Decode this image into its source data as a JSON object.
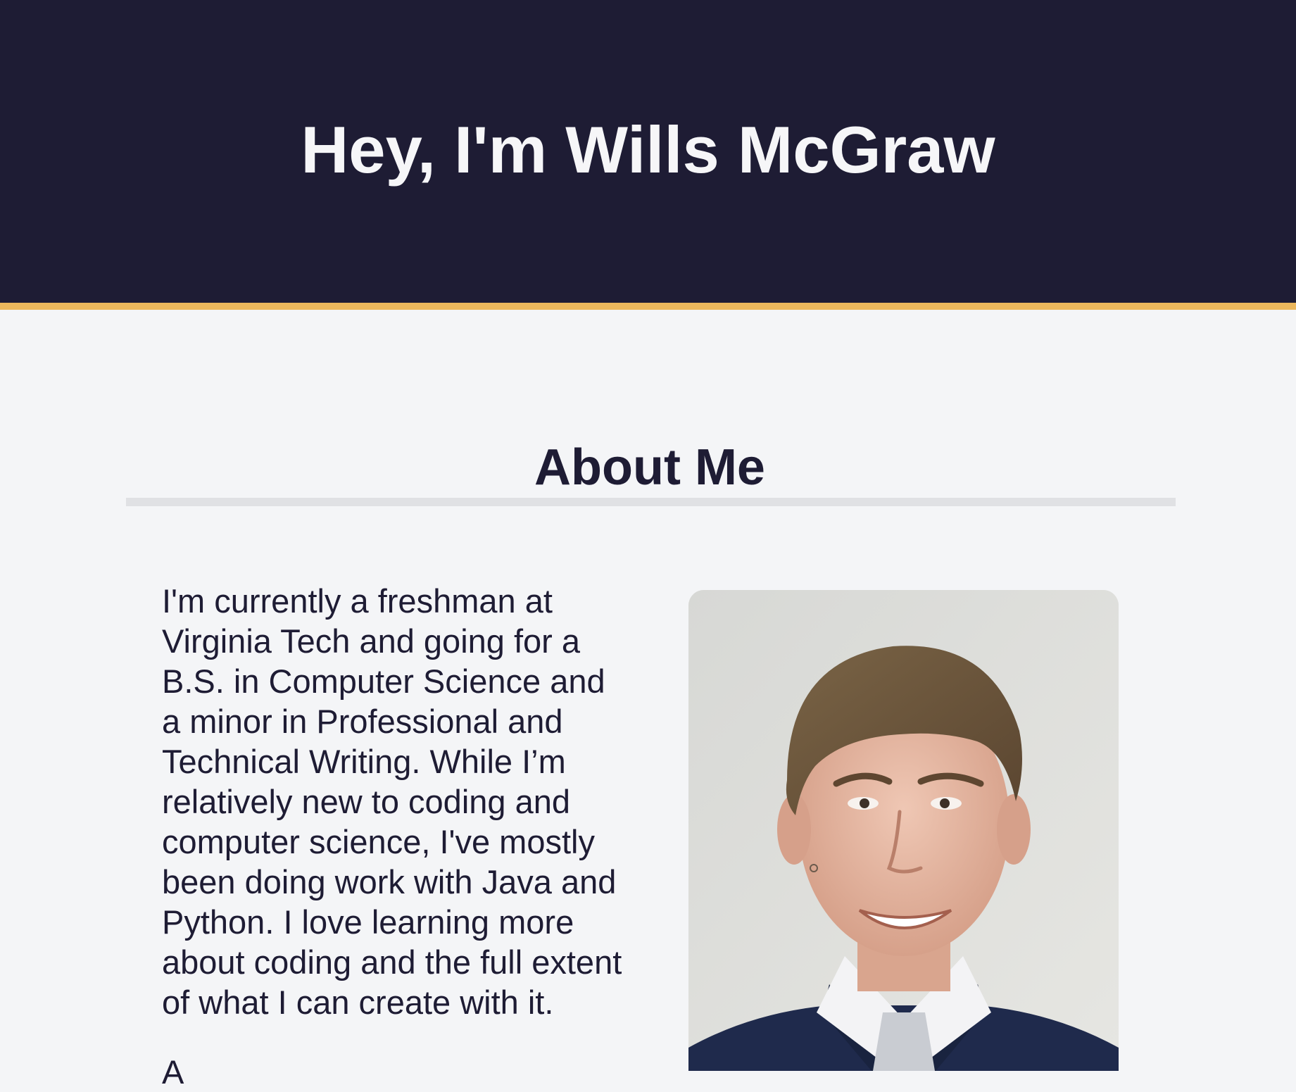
{
  "hero": {
    "title": "Hey, I'm Wills McGraw"
  },
  "about": {
    "heading": "About Me",
    "paragraph_lines": [
      "I'm currently a freshman at",
      "Virginia Tech and going for a",
      "B.S. in Computer Science and",
      "a minor in Professional and",
      "Technical Writing. While I’m",
      "relatively new to coding and",
      "computer science, I've mostly",
      "been doing work with Java and",
      "Python. I love learning more",
      "about coding and the full extent",
      "of what I can create with it."
    ],
    "next_paragraph_start": "A"
  },
  "colors": {
    "hero_background": "#1e1c34",
    "accent": "#ecb75c",
    "page_background": "#f4f5f7",
    "text": "#1e1c34",
    "rule": "#e0e1e4"
  }
}
